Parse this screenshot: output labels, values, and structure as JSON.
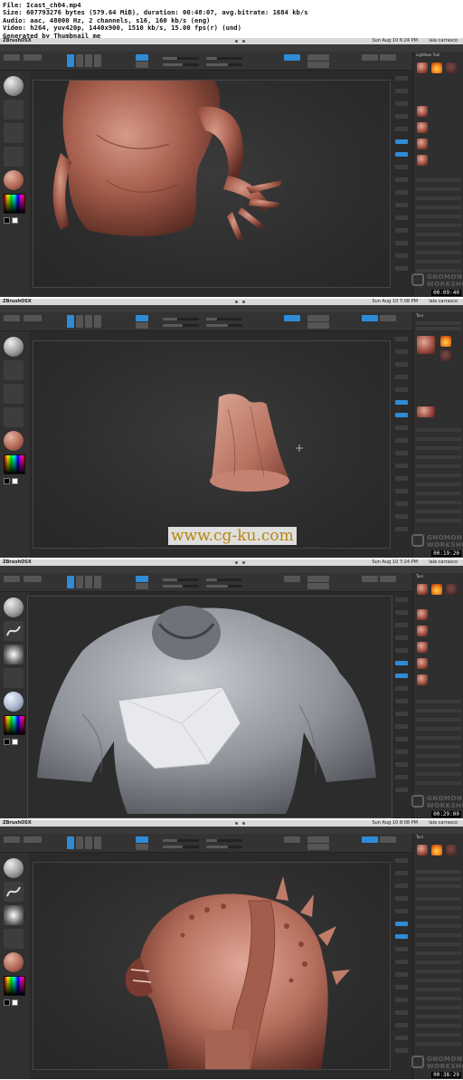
{
  "header": {
    "line1": "File: Icast_ch04.mp4",
    "line2": "Size: 607793276 bytes (579.64 MiB), duration: 00:48:07, avg.bitrate: 1684 kb/s",
    "line3": "Audio: aac, 48000 Hz, 2 channels, s16, 160 kb/s (eng)",
    "line4": "Video: h264, yuv420p, 1440x900, 1510 kb/s, 15.00 fps(r) (und)",
    "line5": "Generated by Thumbnail me"
  },
  "app": {
    "name": "ZBrushOSX",
    "user": "lala carrasco"
  },
  "menus": [
    "Alpha",
    "Brush",
    "Color",
    "Document",
    "Draw",
    "Edit",
    "File",
    "Layer",
    "Light",
    "Macro",
    "Marker",
    "Material",
    "Movie",
    "Picker",
    "Preferences",
    "Render",
    "Stencil",
    "Stroke",
    "Texture",
    "Tool",
    "Transform",
    "Zplugin",
    "Zscript"
  ],
  "watermark": {
    "line1": "GNOMON",
    "line2": "WORKSHOP"
  },
  "overlay_url": "www.cg-ku.com",
  "frames": [
    {
      "clock": "Sun Aug 10  6:24 PM",
      "timecode": "00:09:40",
      "tray_title": "Lightbox Tool"
    },
    {
      "clock": "Sun Aug 10  7:08 PM",
      "timecode": "00:19:20",
      "tray_title": "Tool"
    },
    {
      "clock": "Sun Aug 10  7:24 PM",
      "timecode": "00:29:00",
      "tray_title": "Tool"
    },
    {
      "clock": "Sun Aug 10  8:08 PM",
      "timecode": "00:38:29",
      "tray_title": "Tool"
    }
  ],
  "colors": {
    "accent_blue": "#2e8bd8",
    "ui_background": "#2a2a2a",
    "clay": "#b46a57",
    "grey_material": "#9d9d9d",
    "url_color": "#b8860b"
  }
}
